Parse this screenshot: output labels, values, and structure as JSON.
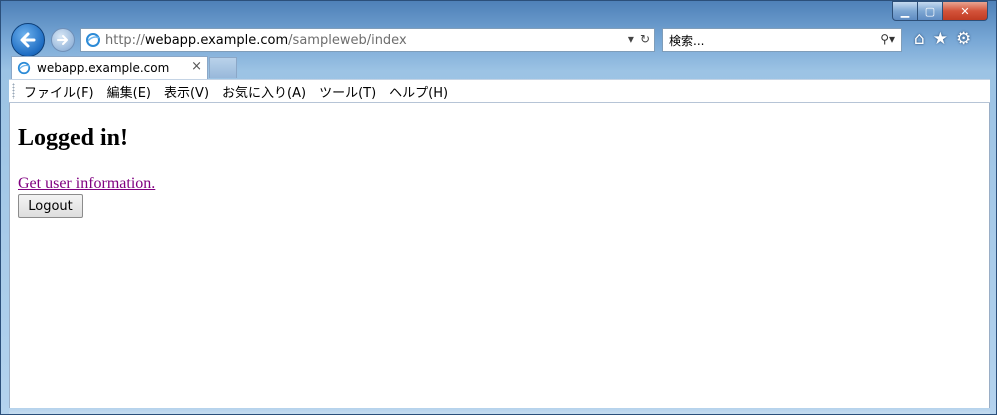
{
  "window": {
    "controls": {
      "minimize": "▁",
      "maximize": "▢",
      "close": "✕"
    }
  },
  "nav": {
    "back_icon": "back-arrow-icon",
    "forward_icon": "forward-arrow-icon"
  },
  "address_bar": {
    "url_prefix": "http://",
    "url_host": "webapp.example.com",
    "url_path": "/sampleweb/index",
    "dropdown_glyph": "▾",
    "refresh_glyph": "↻"
  },
  "search_box": {
    "placeholder": "検索...",
    "search_glyph": "⚲▾"
  },
  "toolbar_icons": {
    "home": "⌂",
    "favorites": "★",
    "tools": "⚙"
  },
  "tabs": [
    {
      "label": "webapp.example.com",
      "close": "×"
    }
  ],
  "menu": {
    "items": [
      "ファイル(F)",
      "編集(E)",
      "表示(V)",
      "お気に入り(A)",
      "ツール(T)",
      "ヘルプ(H)"
    ]
  },
  "page": {
    "heading": "Logged in!",
    "link_text": "Get user information.",
    "logout_label": "Logout"
  },
  "colors": {
    "link_visited": "#800080",
    "chrome_blue": "#5d8fc4",
    "close_red": "#c03b22"
  }
}
